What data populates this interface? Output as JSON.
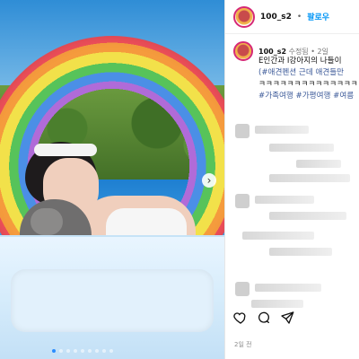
{
  "post": {
    "username": "100_s2",
    "follow_label": "팔로우",
    "separator": "•",
    "caption_meta": {
      "username": "100_s2",
      "edited": "수정됨",
      "time": "2일"
    },
    "caption_lines": [
      "E인간과 I강아지의 나들이",
      "(#애견펜션 근데 애견들만 ",
      "ㅋㅋㅋㅋㅋㅋㅋㅋㅋㅋㅋㅋㅋㅋ",
      "#가족여행 #가평여행 #여름"
    ],
    "time_ago": "2일 전"
  },
  "carousel": {
    "next_label": "›",
    "dots": 9,
    "active_dot": 0
  },
  "actions": {
    "like_icon": "heart-icon",
    "comment_icon": "comment-icon",
    "share_icon": "send-icon"
  }
}
